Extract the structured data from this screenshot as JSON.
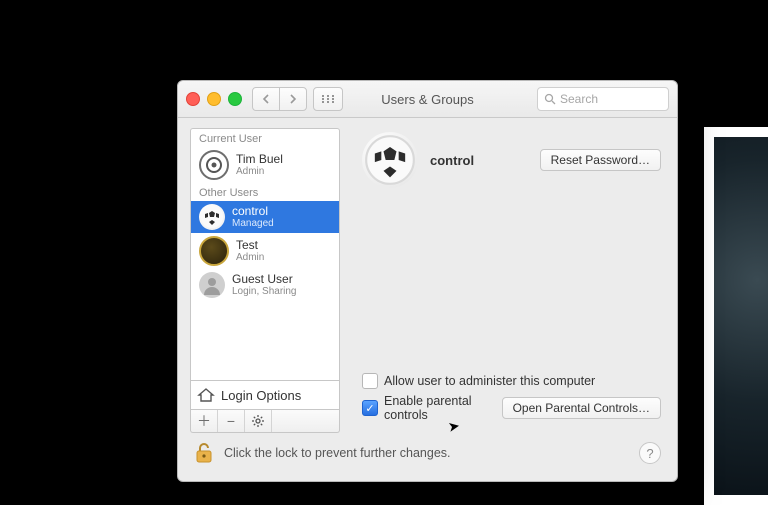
{
  "window": {
    "title": "Users & Groups"
  },
  "search": {
    "placeholder": "Search"
  },
  "sidebar": {
    "section_current": "Current User",
    "section_other": "Other Users",
    "current": {
      "name": "Tim Buel",
      "role": "Admin"
    },
    "others": [
      {
        "name": "control",
        "role": "Managed",
        "selected": true
      },
      {
        "name": "Test",
        "role": "Admin"
      },
      {
        "name": "Guest User",
        "role": "Login, Sharing"
      }
    ],
    "login_options": "Login Options"
  },
  "detail": {
    "username": "control",
    "reset_password": "Reset Password…",
    "allow_admin": "Allow user to administer this computer",
    "allow_admin_checked": false,
    "enable_parental": "Enable parental controls",
    "enable_parental_checked": true,
    "open_parental": "Open Parental Controls…"
  },
  "footer": {
    "lock_text": "Click the lock to prevent further changes."
  }
}
